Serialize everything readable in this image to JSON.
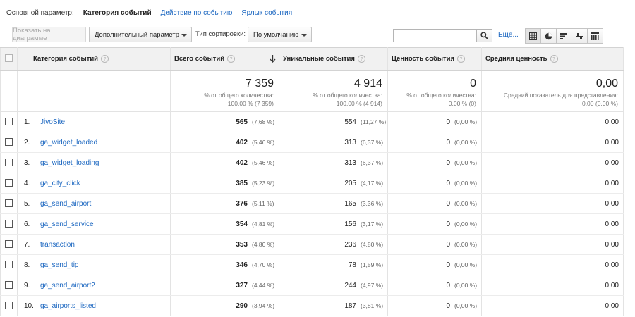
{
  "dimension_bar": {
    "label": "Основной параметр:",
    "active": "Категория событий",
    "links": [
      "Действие по событию",
      "Ярлык события"
    ]
  },
  "toolbar": {
    "plot_button": "Показать на диаграмме",
    "secondary_dimension": "Дополнительный параметр",
    "sort_label": "Тип сортировки:",
    "sort_value": "По умолчанию",
    "search_value": "",
    "search_icon": "search-icon",
    "more_link": "Ещё...",
    "views": [
      "table-view-icon",
      "pie-view-icon",
      "performance-view-icon",
      "comparison-view-icon",
      "pivot-view-icon"
    ]
  },
  "table": {
    "headers": {
      "category": "Категория событий",
      "total": "Всего событий",
      "unique": "Уникальные события",
      "value": "Ценность события",
      "avg": "Средняя ценность"
    },
    "summary": {
      "total": {
        "big": "7 359",
        "l1": "% от общего количества:",
        "l2": "100,00 % (7 359)"
      },
      "unique": {
        "big": "4 914",
        "l1": "% от общего количества:",
        "l2": "100,00 % (4 914)"
      },
      "value": {
        "big": "0",
        "l1": "% от общего количества:",
        "l2": "0,00 % (0)"
      },
      "avg": {
        "big": "0,00",
        "l1": "Средний показатель для представления:",
        "l2": "0,00 (0,00 %)"
      }
    },
    "rows": [
      {
        "idx": "1.",
        "name": "JivoSite",
        "total": "565",
        "total_pct": "(7,68 %)",
        "unique": "554",
        "unique_pct": "(11,27 %)",
        "value": "0",
        "value_pct": "(0,00 %)",
        "avg": "0,00"
      },
      {
        "idx": "2.",
        "name": "ga_widget_loaded",
        "total": "402",
        "total_pct": "(5,46 %)",
        "unique": "313",
        "unique_pct": "(6,37 %)",
        "value": "0",
        "value_pct": "(0,00 %)",
        "avg": "0,00"
      },
      {
        "idx": "3.",
        "name": "ga_widget_loading",
        "total": "402",
        "total_pct": "(5,46 %)",
        "unique": "313",
        "unique_pct": "(6,37 %)",
        "value": "0",
        "value_pct": "(0,00 %)",
        "avg": "0,00"
      },
      {
        "idx": "4.",
        "name": "ga_city_click",
        "total": "385",
        "total_pct": "(5,23 %)",
        "unique": "205",
        "unique_pct": "(4,17 %)",
        "value": "0",
        "value_pct": "(0,00 %)",
        "avg": "0,00"
      },
      {
        "idx": "5.",
        "name": "ga_send_airport",
        "total": "376",
        "total_pct": "(5,11 %)",
        "unique": "165",
        "unique_pct": "(3,36 %)",
        "value": "0",
        "value_pct": "(0,00 %)",
        "avg": "0,00"
      },
      {
        "idx": "6.",
        "name": "ga_send_service",
        "total": "354",
        "total_pct": "(4,81 %)",
        "unique": "156",
        "unique_pct": "(3,17 %)",
        "value": "0",
        "value_pct": "(0,00 %)",
        "avg": "0,00"
      },
      {
        "idx": "7.",
        "name": "transaction",
        "total": "353",
        "total_pct": "(4,80 %)",
        "unique": "236",
        "unique_pct": "(4,80 %)",
        "value": "0",
        "value_pct": "(0,00 %)",
        "avg": "0,00"
      },
      {
        "idx": "8.",
        "name": "ga_send_tip",
        "total": "346",
        "total_pct": "(4,70 %)",
        "unique": "78",
        "unique_pct": "(1,59 %)",
        "value": "0",
        "value_pct": "(0,00 %)",
        "avg": "0,00"
      },
      {
        "idx": "9.",
        "name": "ga_send_airport2",
        "total": "327",
        "total_pct": "(4,44 %)",
        "unique": "244",
        "unique_pct": "(4,97 %)",
        "value": "0",
        "value_pct": "(0,00 %)",
        "avg": "0,00"
      },
      {
        "idx": "10.",
        "name": "ga_airports_listed",
        "total": "290",
        "total_pct": "(3,94 %)",
        "unique": "187",
        "unique_pct": "(3,81 %)",
        "value": "0",
        "value_pct": "(0,00 %)",
        "avg": "0,00"
      }
    ]
  },
  "colors": {
    "link": "#1a66c0",
    "header_bg": "#f1f1f1"
  }
}
